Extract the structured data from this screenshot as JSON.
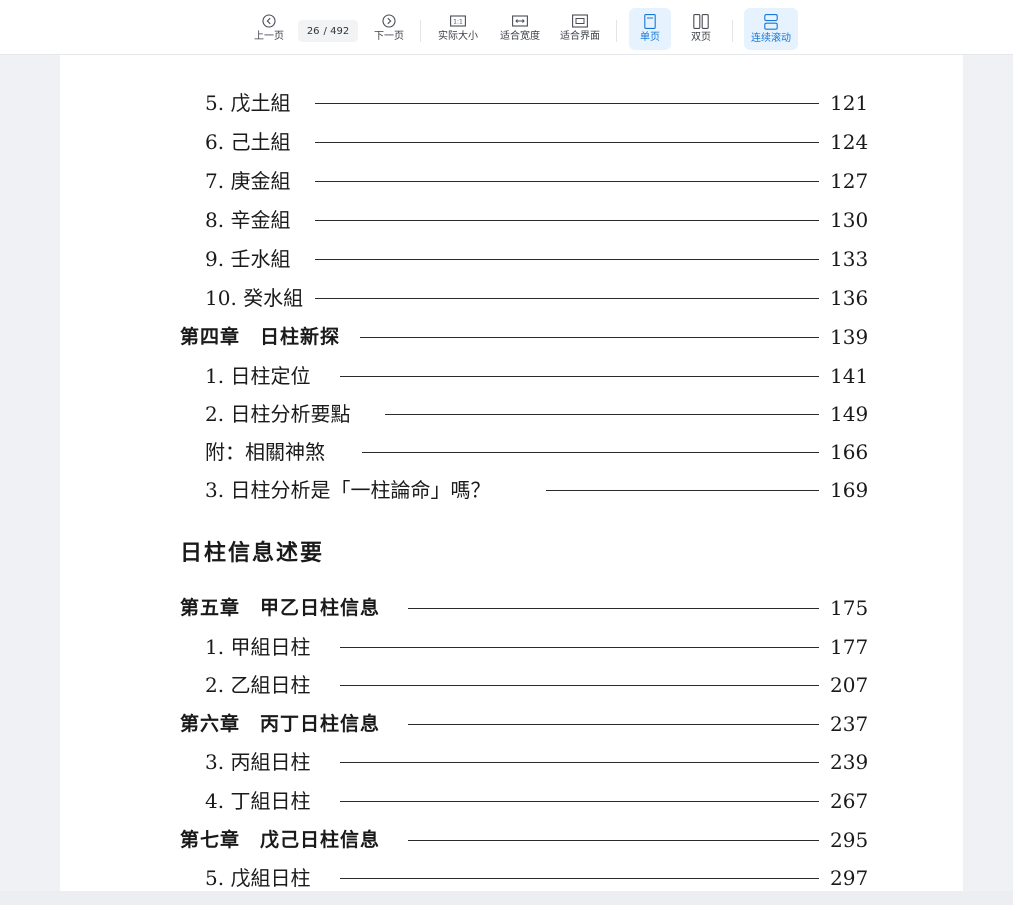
{
  "toolbar": {
    "prev": "上一页",
    "page_current": "26",
    "page_total": "/ 492",
    "next": "下一页",
    "actual_size": "实际大小",
    "fit_width": "适合宽度",
    "fit_page": "适合界面",
    "single_page": "单页",
    "double_page": "双页",
    "continuous": "连续滚动",
    "actual_size_glyph": "1:1"
  },
  "toc": {
    "entries": [
      {
        "title": "5. 戊土組",
        "page": "121"
      },
      {
        "title": "6. 己土組",
        "page": "124"
      },
      {
        "title": "7. 庚金組",
        "page": "127"
      },
      {
        "title": "8. 辛金組",
        "page": "130"
      },
      {
        "title": "9. 壬水組",
        "page": "133"
      },
      {
        "title": "10. 癸水組",
        "page": "136"
      },
      {
        "title": "第四章　日柱新探",
        "page": "139"
      },
      {
        "title": "1. 日柱定位",
        "page": "141"
      },
      {
        "title": "2. 日柱分析要點",
        "page": "149"
      },
      {
        "title": "附：相關神煞",
        "page": "166"
      },
      {
        "title": "3. 日柱分析是「一柱論命」嗎？",
        "page": "169"
      },
      {
        "title": "第五章　甲乙日柱信息",
        "page": "175"
      },
      {
        "title": "1. 甲組日柱",
        "page": "177"
      },
      {
        "title": "2. 乙組日柱",
        "page": "207"
      },
      {
        "title": "第六章　丙丁日柱信息",
        "page": "237"
      },
      {
        "title": "3. 丙組日柱",
        "page": "239"
      },
      {
        "title": "4. 丁組日柱",
        "page": "267"
      },
      {
        "title": "第七章　戊己日柱信息",
        "page": "295"
      },
      {
        "title": "5. 戊組日柱",
        "page": "297"
      }
    ],
    "section_heading": "日柱信息述要"
  },
  "colors": {
    "accent": "#1677d8",
    "active_bg": "#e6f2fe"
  }
}
